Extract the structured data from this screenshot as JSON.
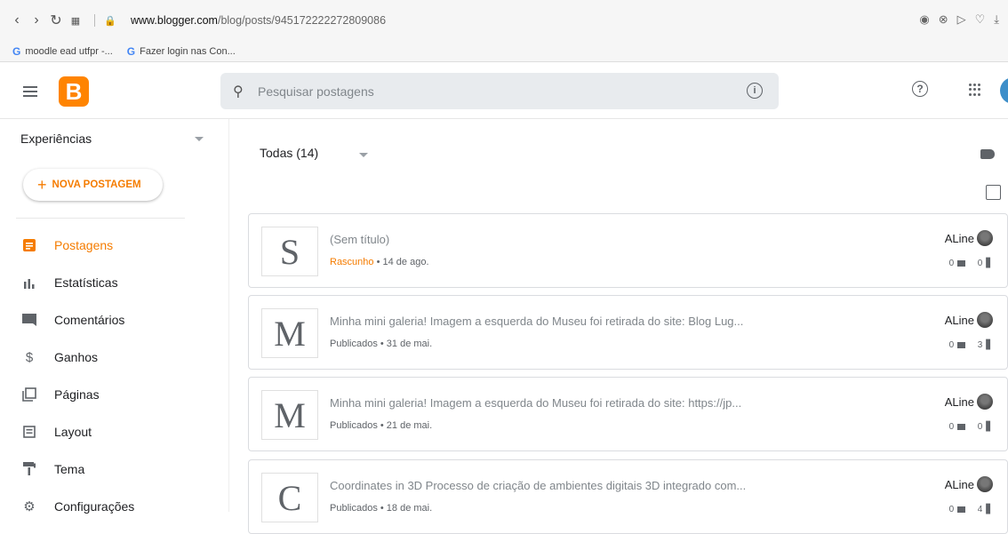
{
  "browser": {
    "url_host": "www.blogger.com",
    "url_path": "/blog/posts/945172222272809086",
    "bookmarks": [
      "moodle ead utfpr -...",
      "Fazer login nas Con..."
    ]
  },
  "topbar": {
    "search_placeholder": "Pesquisar postagens"
  },
  "sidebar": {
    "blog_name": "Experiências",
    "new_post_label": "NOVA POSTAGEM",
    "items": [
      {
        "label": "Postagens",
        "icon": "posts-icon"
      },
      {
        "label": "Estatísticas",
        "icon": "stats-icon"
      },
      {
        "label": "Comentários",
        "icon": "comments-icon"
      },
      {
        "label": "Ganhos",
        "icon": "dollar-icon"
      },
      {
        "label": "Páginas",
        "icon": "pages-icon"
      },
      {
        "label": "Layout",
        "icon": "layout-icon"
      },
      {
        "label": "Tema",
        "icon": "paint-roller-icon"
      },
      {
        "label": "Configurações",
        "icon": "gear-icon"
      }
    ]
  },
  "main": {
    "filter_label": "Todas (14)",
    "posts": [
      {
        "thumb": "S",
        "title": "(Sem título)",
        "status": "Rascunho",
        "date": "• 14 de ago.",
        "author": "ALine",
        "comments": "0",
        "views": "0"
      },
      {
        "thumb": "M",
        "title": "Minha mini galeria! Imagem a esquerda do Museu foi retirada do site: Blog Lug...",
        "status": "Publicados",
        "date": "• 31 de mai.",
        "author": "ALine",
        "comments": "0",
        "views": "3"
      },
      {
        "thumb": "M",
        "title": "Minha mini galeria! Imagem a esquerda do Museu foi retirada do site: https://jp...",
        "status": "Publicados",
        "date": "• 21 de mai.",
        "author": "ALine",
        "comments": "0",
        "views": "0"
      },
      {
        "thumb": "C",
        "title": "Coordinates in 3D Processo de criação de ambientes digitais 3D integrado com...",
        "status": "Publicados",
        "date": "• 18 de mai.",
        "author": "ALine",
        "comments": "0",
        "views": "4"
      }
    ]
  },
  "colors": {
    "accent": "#f57c00",
    "logo": "#ff8400"
  }
}
